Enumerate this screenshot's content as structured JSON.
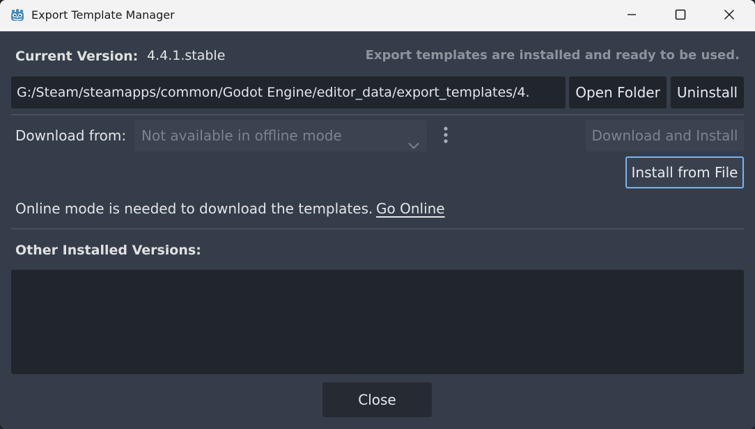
{
  "window": {
    "title": "Export Template Manager",
    "icon": "godot-icon"
  },
  "current": {
    "label": "Current Version:",
    "version": "4.4.1.stable",
    "status": "Export templates are installed and ready to be used.",
    "path": "G:/Steam/steamapps/common/Godot Engine/editor_data/export_templates/4.",
    "open_folder_label": "Open Folder",
    "uninstall_label": "Uninstall"
  },
  "download": {
    "label": "Download from:",
    "selected_mirror": "Not available in offline mode",
    "download_install_label": "Download and Install",
    "install_from_file_label": "Install from File"
  },
  "online_notice": {
    "text": "Online mode is needed to download the templates.",
    "link_label": "Go Online"
  },
  "other_versions": {
    "label": "Other Installed Versions:",
    "items": []
  },
  "footer": {
    "close_label": "Close"
  },
  "colors": {
    "window_bg": "#363d4a",
    "field_bg": "#21252c",
    "focus_border": "#7ab4f0",
    "text": "#e3e5ea",
    "muted_text": "#7e848e"
  }
}
